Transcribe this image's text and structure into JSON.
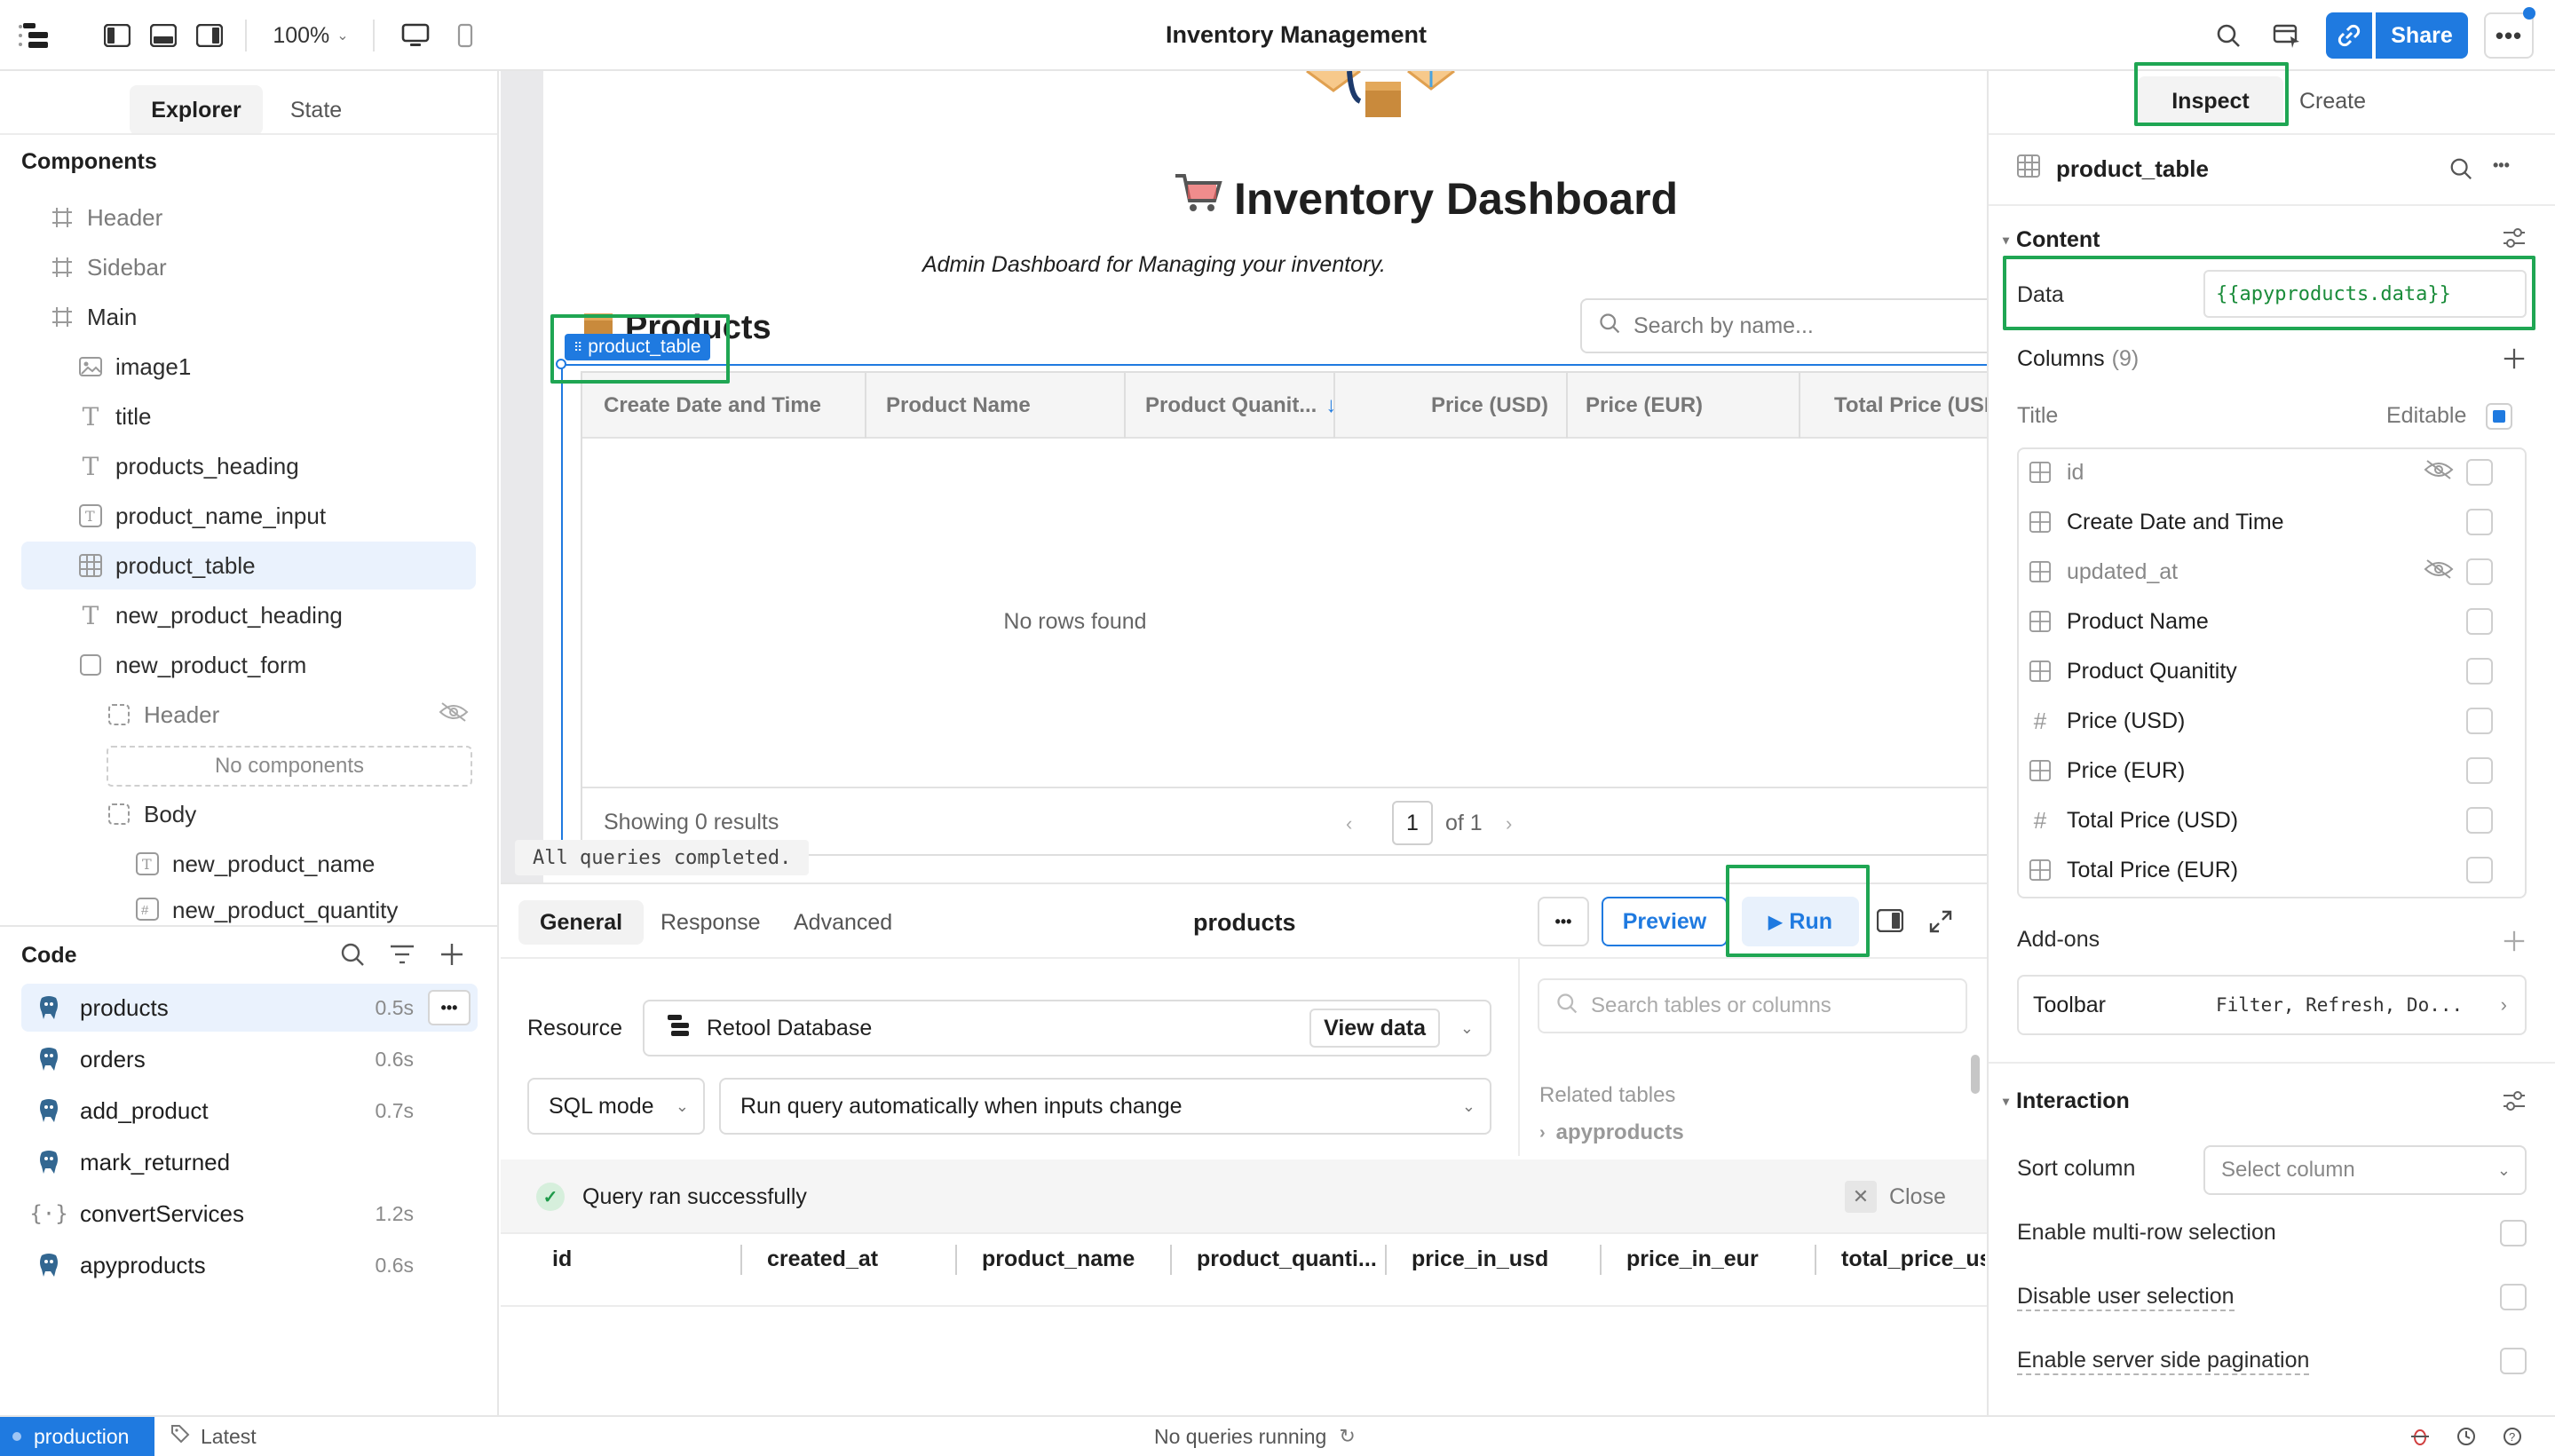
{
  "topbar": {
    "zoom": "100%",
    "app_title": "Inventory Management",
    "share_label": "Share"
  },
  "left": {
    "tabs": [
      "Explorer",
      "State"
    ],
    "components_title": "Components",
    "tree": [
      {
        "label": "Header",
        "icon": "frame-icon"
      },
      {
        "label": "Sidebar",
        "icon": "frame-icon"
      },
      {
        "label": "Main",
        "icon": "frame-icon"
      },
      {
        "label": "image1",
        "icon": "image-icon"
      },
      {
        "label": "title",
        "icon": "text-icon"
      },
      {
        "label": "products_heading",
        "icon": "text-icon"
      },
      {
        "label": "product_name_input",
        "icon": "text-input-icon"
      },
      {
        "label": "product_table",
        "icon": "table-icon"
      },
      {
        "label": "new_product_heading",
        "icon": "text-icon"
      },
      {
        "label": "new_product_form",
        "icon": "form-icon"
      },
      {
        "label": "Header",
        "icon": "container-icon"
      },
      {
        "label": "No components",
        "icon": ""
      },
      {
        "label": "Body",
        "icon": "container-icon"
      },
      {
        "label": "new_product_name",
        "icon": "text-input-icon"
      },
      {
        "label": "new_product_quantity",
        "icon": "number-input-icon"
      }
    ],
    "code_title": "Code",
    "queries": [
      {
        "label": "products",
        "time": "0.5s"
      },
      {
        "label": "orders",
        "time": "0.6s"
      },
      {
        "label": "add_product",
        "time": "0.7s"
      },
      {
        "label": "mark_returned",
        "time": ""
      },
      {
        "label": "convertServices",
        "time": "1.2s"
      },
      {
        "label": "apyproducts",
        "time": "0.6s"
      }
    ]
  },
  "canvas": {
    "dashboard_title": "Inventory Dashboard",
    "dashboard_subtitle": "Admin Dashboard for Managing your inventory.",
    "products_heading": "Products",
    "selected_badge": "product_table",
    "search_placeholder": "Search by name...",
    "table_headers": [
      "Create Date and Time",
      "Product Name",
      "Product Quanit...",
      "Price (USD)",
      "Price (EUR)",
      "Total Price (USD"
    ],
    "empty_text": "No rows found",
    "showing": "Showing 0 results",
    "page": "1",
    "page_of": "of 1",
    "status_toast": "All queries completed."
  },
  "query": {
    "tabs": [
      "General",
      "Response",
      "Advanced"
    ],
    "name": "products",
    "preview_label": "Preview",
    "run_label": "Run",
    "resource_label": "Resource",
    "resource_value": "Retool Database",
    "view_data_label": "View data",
    "mode_value": "SQL mode",
    "trigger_value": "Run query automatically when inputs change",
    "search_tables_placeholder": "Search tables or columns",
    "related_tables_label": "Related tables",
    "related_table": "apyproducts",
    "success_text": "Query ran successfully",
    "close_label": "Close",
    "result_headers": [
      "id",
      "created_at",
      "product_name",
      "product_quanti...",
      "price_in_usd",
      "price_in_eur",
      "total_price_us"
    ]
  },
  "right": {
    "tabs": [
      "Inspect",
      "Create"
    ],
    "component_name": "product_table",
    "content_label": "Content",
    "data_label": "Data",
    "data_value": "{{apyproducts.data}}",
    "columns_label": "Columns",
    "columns_count": "(9)",
    "title_label": "Title",
    "editable_label": "Editable",
    "columns": [
      {
        "label": "id",
        "icon": "table-col-icon",
        "hidden": true
      },
      {
        "label": "Create Date and Time",
        "icon": "table-col-icon",
        "hidden": false
      },
      {
        "label": "updated_at",
        "icon": "table-col-icon",
        "hidden": true
      },
      {
        "label": "Product Name",
        "icon": "table-col-icon",
        "hidden": false
      },
      {
        "label": "Product Quanitity",
        "icon": "table-col-icon",
        "hidden": false
      },
      {
        "label": "Price (USD)",
        "icon": "hash-icon",
        "hidden": false
      },
      {
        "label": "Price (EUR)",
        "icon": "table-col-icon",
        "hidden": false
      },
      {
        "label": "Total Price (USD)",
        "icon": "hash-icon",
        "hidden": false
      },
      {
        "label": "Total Price (EUR)",
        "icon": "table-col-icon",
        "hidden": false
      }
    ],
    "addons_label": "Add-ons",
    "toolbar_label": "Toolbar",
    "toolbar_value": "Filter, Refresh, Do...",
    "interaction_label": "Interaction",
    "sort_column_label": "Sort column",
    "sort_column_placeholder": "Select column",
    "multi_row_label": "Enable multi-row selection",
    "disable_selection_label": "Disable user selection",
    "server_pagination_label": "Enable server side pagination"
  },
  "statusbar": {
    "env": "production",
    "version": "Latest",
    "running": "No queries running"
  },
  "colors": {
    "accent": "#1f7ae0",
    "highlight": "#1fa653"
  }
}
